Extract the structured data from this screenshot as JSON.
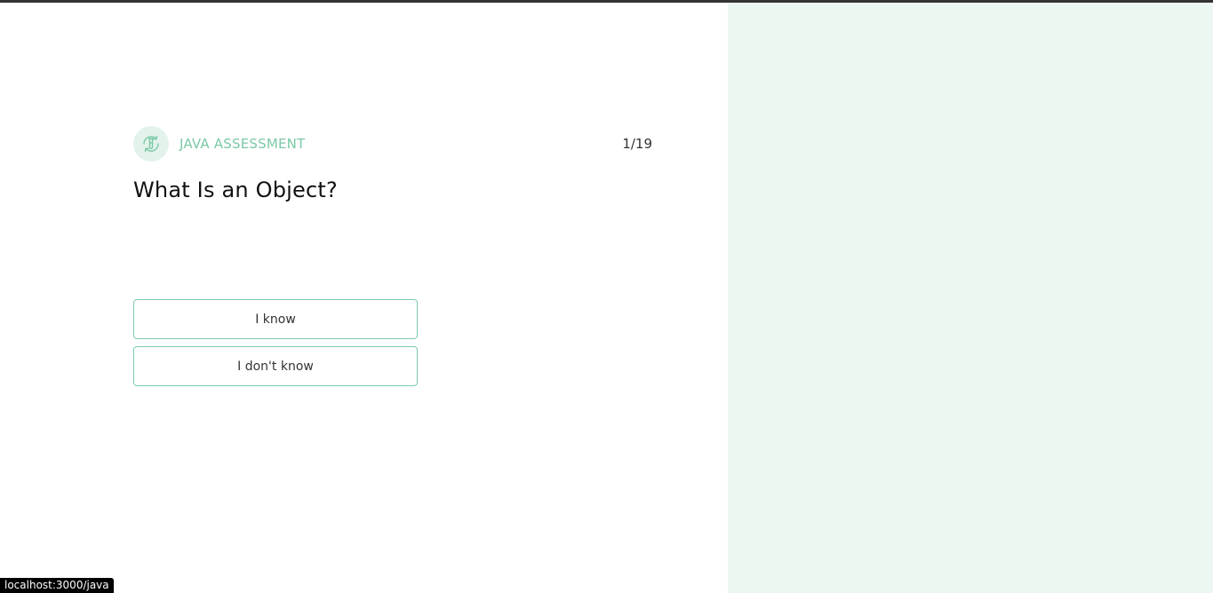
{
  "assessment": {
    "label": "JAVA ASSESSMENT",
    "progress": "1/19",
    "icon": "test-tube-refresh-icon"
  },
  "question": {
    "title": "What Is an Object?"
  },
  "answers": {
    "know_label": "I know",
    "dont_know_label": "I don't know"
  },
  "status_bar": {
    "url": "localhost:3000/java"
  },
  "colors": {
    "accent": "#7cc9a6",
    "right_panel": "#edf7f1",
    "button_border": "#7cc9b2"
  }
}
